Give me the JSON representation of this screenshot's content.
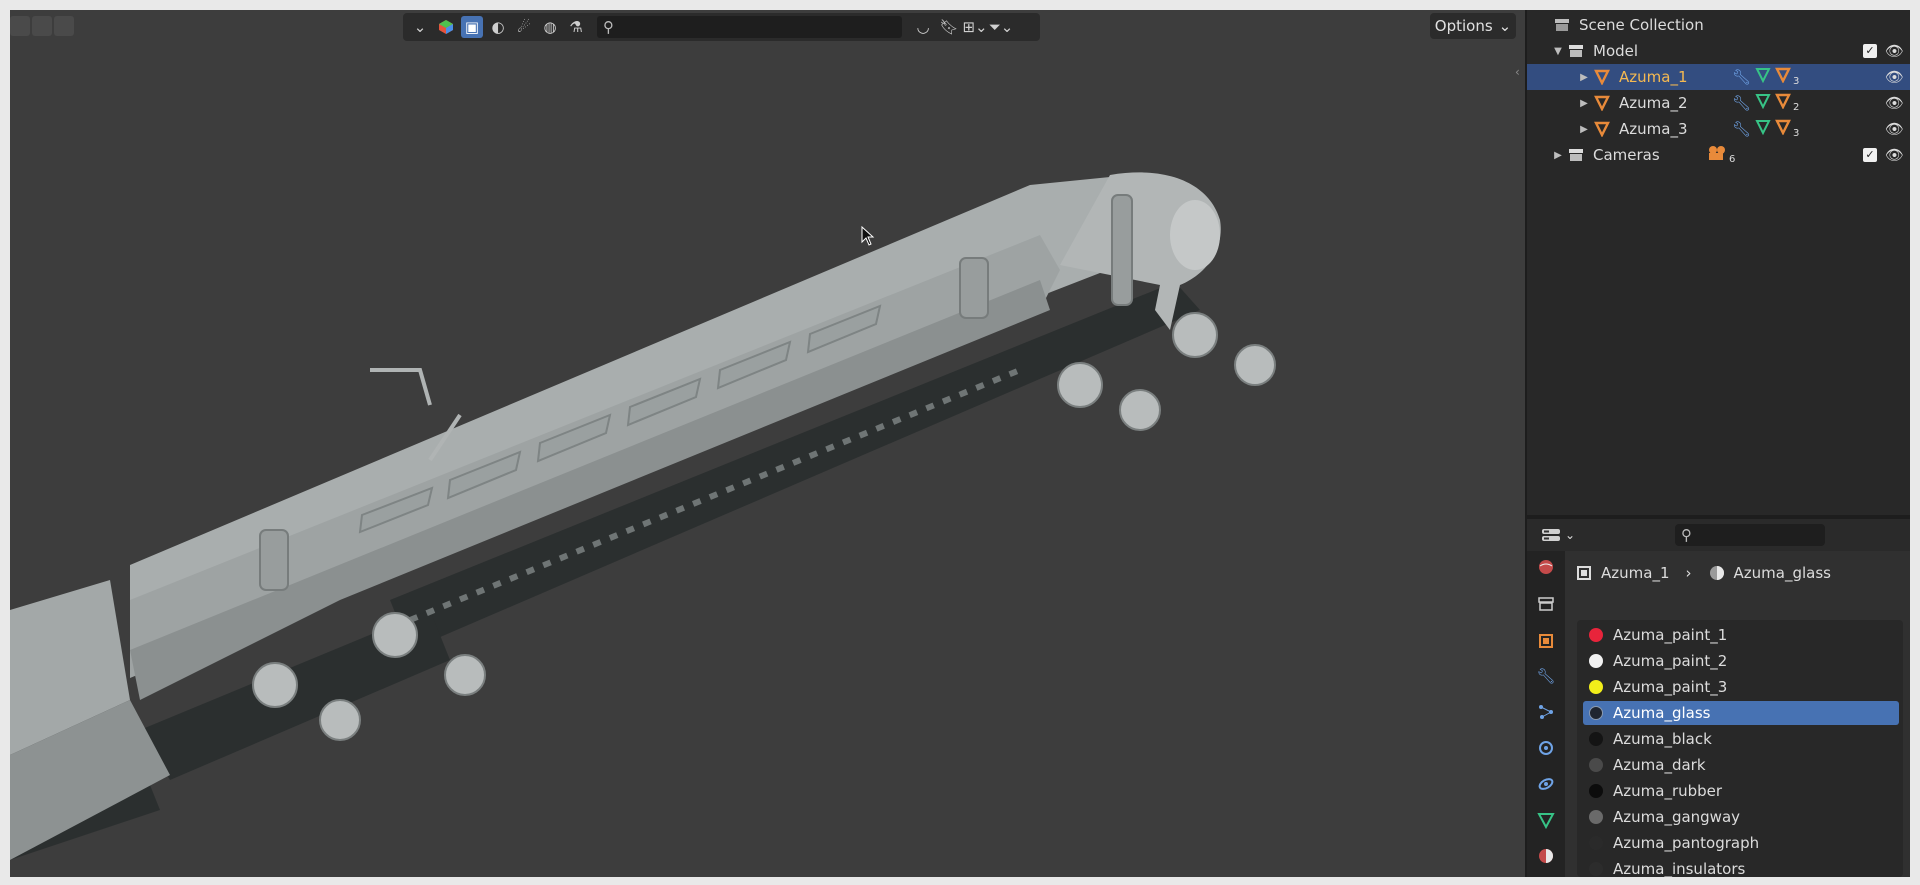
{
  "viewport": {
    "filter_search_placeholder": "",
    "options_label": "Options"
  },
  "outliner": {
    "scene_collection": "Scene Collection",
    "rows": [
      {
        "label": "Model",
        "badge": ""
      },
      {
        "label": "Azuma_1",
        "badge": "3"
      },
      {
        "label": "Azuma_2",
        "badge": "2"
      },
      {
        "label": "Azuma_3",
        "badge": "3"
      },
      {
        "label": "Cameras",
        "badge": "6"
      }
    ]
  },
  "properties": {
    "search_placeholder": "",
    "breadcrumb": {
      "object": "Azuma_1",
      "material": "Azuma_glass"
    },
    "materials": [
      {
        "name": "Azuma_paint_1",
        "color": "#e8243b"
      },
      {
        "name": "Azuma_paint_2",
        "color": "#f2f2f2"
      },
      {
        "name": "Azuma_paint_3",
        "color": "#f2ee1a"
      },
      {
        "name": "Azuma_glass",
        "color": "#1f2530"
      },
      {
        "name": "Azuma_black",
        "color": "#141414"
      },
      {
        "name": "Azuma_dark",
        "color": "#4a4a4a"
      },
      {
        "name": "Azuma_rubber",
        "color": "#0c0c0c"
      },
      {
        "name": "Azuma_gangway",
        "color": "#6a6a6a"
      },
      {
        "name": "Azuma_pantograph",
        "color": "#2a2a2a"
      },
      {
        "name": "Azuma_insulators",
        "color": "#2c2c2c"
      }
    ],
    "selected_material": "Azuma_glass"
  },
  "colors": {
    "accent": "#4772b3",
    "selected_row": "#334d80",
    "selected_text": "#f5b951",
    "mesh_orange": "#e88a3a",
    "modifier_blue": "#6fa3e6",
    "data_green": "#37c386"
  }
}
